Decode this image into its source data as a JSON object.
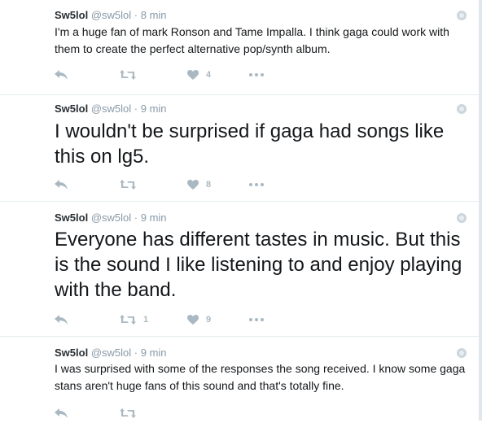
{
  "tweets": [
    {
      "fullname": "Sw5lol",
      "username": "@sw5lol",
      "dot": "·",
      "time": "8 min",
      "text": "I'm a huge fan of mark Ronson and Tame Impalla. I think gaga could work with them to create the perfect alternative pop/synth album.",
      "retweets": "",
      "likes": "4"
    },
    {
      "fullname": "Sw5lol",
      "username": "@sw5lol",
      "dot": "·",
      "time": "9 min",
      "text": "I wouldn't be surprised if gaga had songs like this on lg5.",
      "retweets": "",
      "likes": "8"
    },
    {
      "fullname": "Sw5lol",
      "username": "@sw5lol",
      "dot": "·",
      "time": "9 min",
      "text": "Everyone has different tastes in music. But this is the sound I like listening to and enjoy playing with the band.",
      "retweets": "1",
      "likes": "9"
    },
    {
      "fullname": "Sw5lol",
      "username": "@sw5lol",
      "dot": "·",
      "time": "9 min",
      "text": "I was surprised with some of the responses the song received. I know some gaga stans aren't huge fans of this sound and that's totally fine.",
      "retweets": "",
      "likes": ""
    }
  ],
  "icons": {
    "reply": "reply-icon",
    "retweet": "retweet-icon",
    "like": "heart-icon",
    "more": "more-icon",
    "globe": "globe-icon"
  },
  "colors": {
    "action_gray": "#aab8c2",
    "meta_gray": "#8899a6",
    "text": "#14171a",
    "divider": "#e6ecf0"
  }
}
